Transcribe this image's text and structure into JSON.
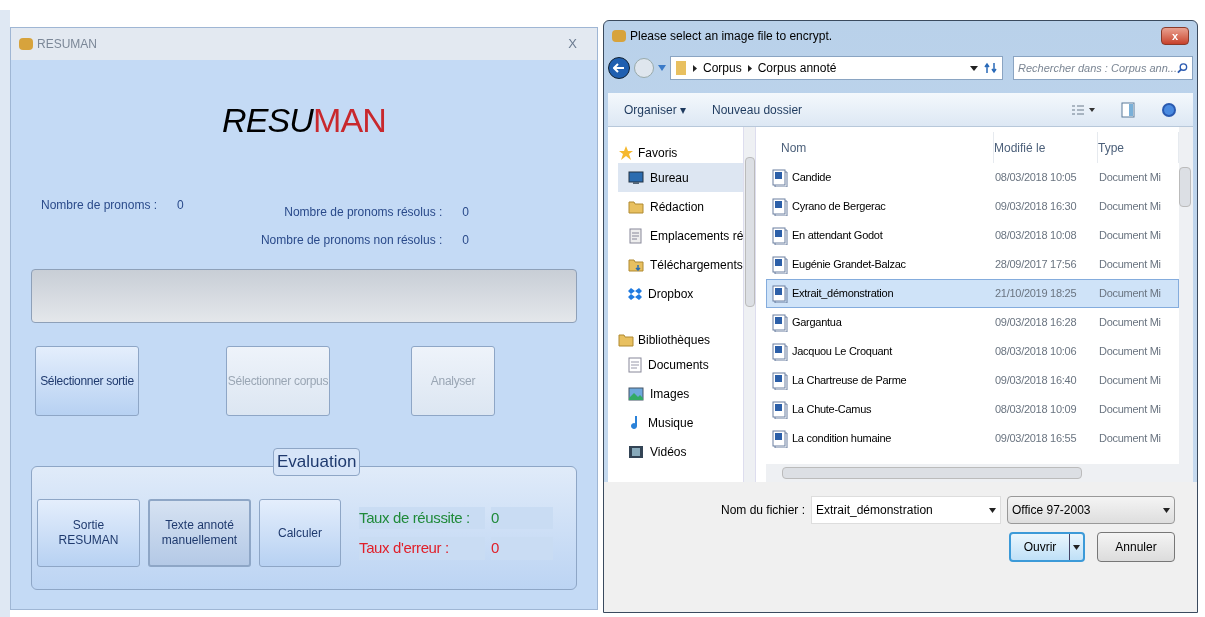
{
  "app": {
    "title": "RESUMAN",
    "close": "X",
    "logo_a": "RESU",
    "logo_b": "MAN",
    "stats": [
      {
        "label": "Nombre de pronoms :",
        "value": "0"
      },
      {
        "label": "Nombre de pronoms résolus :",
        "value": "0"
      },
      {
        "label": "Nombre de pronoms non résolus :",
        "value": "0"
      }
    ],
    "actions": [
      {
        "label": "Sélectionner sortie",
        "disabled": false
      },
      {
        "label": "Sélectionner corpus",
        "disabled": true
      },
      {
        "label": "Analyser",
        "disabled": true
      }
    ],
    "evaluation": {
      "legend": "Evaluation",
      "buttons": [
        {
          "label": "Sortie RESUMAN",
          "selected": false
        },
        {
          "label": "Texte annoté manuellement",
          "selected": true
        },
        {
          "label": "Calculer",
          "selected": false
        }
      ],
      "rates": [
        {
          "label": "Taux de réussite :",
          "value": "0",
          "color": "#1f8a3a"
        },
        {
          "label": "Taux d'erreur :",
          "value": "0",
          "color": "#e0202a"
        }
      ]
    }
  },
  "dialog": {
    "title": "Please select an image file to encrypt.",
    "close": "x",
    "breadcrumb": [
      "Corpus",
      "Corpus annoté"
    ],
    "search": {
      "placeholder": "Rechercher dans : Corpus ann..."
    },
    "toolbar": [
      "Organiser ▾",
      "Nouveau dossier"
    ],
    "nav": [
      {
        "label": "Favoris",
        "kind": "star",
        "children": [
          {
            "label": "Bureau",
            "kind": "desktop",
            "selected": true
          },
          {
            "label": "Rédaction",
            "kind": "folder",
            "selected": false
          },
          {
            "label": "Emplacements ré",
            "kind": "places",
            "selected": false
          },
          {
            "label": "Téléchargements",
            "kind": "download",
            "selected": false
          },
          {
            "label": "Dropbox",
            "kind": "dropbox",
            "selected": false
          }
        ]
      },
      {
        "label": "Bibliothèques",
        "kind": "library",
        "children": [
          {
            "label": "Documents",
            "kind": "doc",
            "selected": false
          },
          {
            "label": "Images",
            "kind": "image",
            "selected": false
          },
          {
            "label": "Musique",
            "kind": "music",
            "selected": false
          },
          {
            "label": "Vidéos",
            "kind": "video",
            "selected": false
          }
        ]
      }
    ],
    "columns": [
      "Nom",
      "Modifié le",
      "Type"
    ],
    "files": [
      {
        "name": "Candide",
        "date": "08/03/2018 10:05",
        "type": "Document Mi",
        "selected": false
      },
      {
        "name": "Cyrano de Bergerac",
        "date": "09/03/2018 16:30",
        "type": "Document Mi",
        "selected": false
      },
      {
        "name": "En attendant Godot",
        "date": "08/03/2018 10:08",
        "type": "Document Mi",
        "selected": false
      },
      {
        "name": "Eugénie Grandet-Balzac",
        "date": "28/09/2017 17:56",
        "type": "Document Mi",
        "selected": false
      },
      {
        "name": "Extrait_démonstration",
        "date": "21/10/2019 18:25",
        "type": "Document Mi",
        "selected": true
      },
      {
        "name": "Gargantua",
        "date": "09/03/2018 16:28",
        "type": "Document Mi",
        "selected": false
      },
      {
        "name": "Jacquou Le Croquant",
        "date": "08/03/2018 10:06",
        "type": "Document Mi",
        "selected": false
      },
      {
        "name": "La Chartreuse de Parme",
        "date": "09/03/2018 16:40",
        "type": "Document Mi",
        "selected": false
      },
      {
        "name": "La Chute-Camus",
        "date": "08/03/2018 10:09",
        "type": "Document Mi",
        "selected": false
      },
      {
        "name": "La condition humaine",
        "date": "09/03/2018 16:55",
        "type": "Document Mi",
        "selected": false
      }
    ],
    "filename_label": "Nom du fichier :",
    "filename": "Extrait_démonstration",
    "filter": "Office 97-2003",
    "open": "Ouvrir",
    "cancel": "Annuler"
  }
}
